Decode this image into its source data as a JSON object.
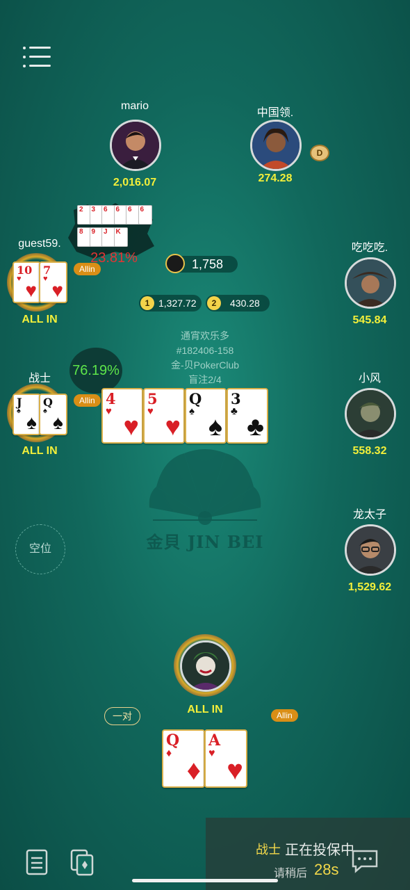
{
  "menu": {
    "icon": "menu-icon"
  },
  "players": {
    "mario": {
      "name": "mario",
      "stack": "2,016.07"
    },
    "zhongguo": {
      "name": "中国领.",
      "stack": "274.28",
      "dealer": "D"
    },
    "guest59": {
      "name": "guest59.",
      "status": "ALL IN",
      "badge": "Allin",
      "equity": "23.81%"
    },
    "chichichi": {
      "name": "吃吃吃.",
      "stack": "545.84"
    },
    "zhanshi": {
      "name": "战士",
      "status": "ALL IN",
      "badge": "Allin",
      "equity": "76.19%"
    },
    "xiaofeng": {
      "name": "小风",
      "stack": "558.32"
    },
    "longtaizi": {
      "name": "龙太子",
      "stack": "1,529.62"
    },
    "hero": {
      "status": "ALL IN",
      "badge": "Allin",
      "hand_type": "一对"
    }
  },
  "pot": {
    "main": "1,758",
    "side1_no": "1",
    "side1": "1,327.72",
    "side2_no": "2",
    "side2": "430.28"
  },
  "table": {
    "name": "通宵欢乐多",
    "id": "#182406-158",
    "club": "金-贝PokerClub",
    "blinds": "盲注2/4",
    "watermark": "金貝 JIN BEI"
  },
  "empty_seat": "空位",
  "cards": {
    "guest59": [
      {
        "rank": "10",
        "suit": "♥"
      },
      {
        "rank": "7",
        "suit": "♥"
      }
    ],
    "zhanshi": [
      {
        "rank": "J",
        "suit": "♠"
      },
      {
        "rank": "Q",
        "suit": "♠"
      }
    ],
    "board": [
      {
        "rank": "4",
        "suit": "♥"
      },
      {
        "rank": "5",
        "suit": "♥"
      },
      {
        "rank": "Q",
        "suit": "♠"
      },
      {
        "rank": "3",
        "suit": "♣"
      }
    ],
    "hero": [
      {
        "rank": "Q",
        "suit": "♦"
      },
      {
        "rank": "A",
        "suit": "♥"
      }
    ],
    "outs_row1": [
      "2",
      "3",
      "6",
      "6",
      "6",
      "6"
    ],
    "outs_row2": [
      "8",
      "9",
      "J",
      "K"
    ]
  },
  "notice": {
    "player": "战士",
    "action": "正在投保中",
    "wait": "请稍后",
    "timer": "28s"
  },
  "bottom": {
    "history_icon": "history-icon",
    "cards_icon": "card-stack-icon",
    "chat_icon": "chat-icon"
  }
}
